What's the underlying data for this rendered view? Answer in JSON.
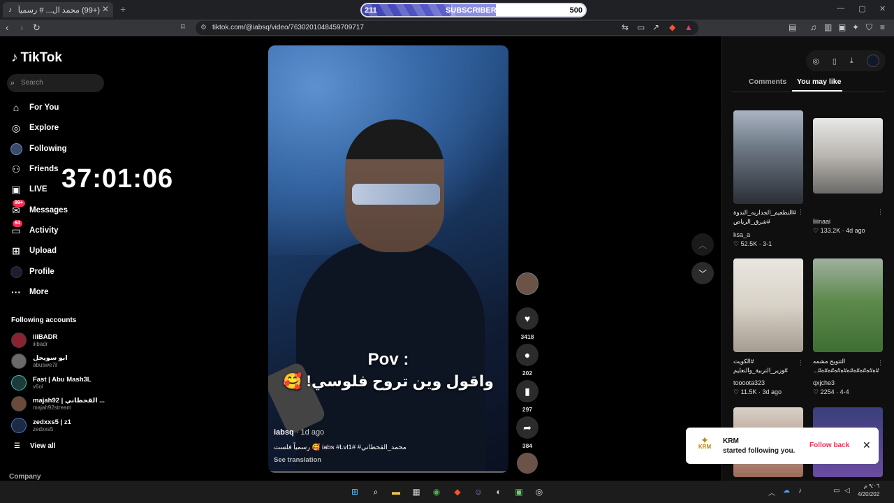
{
  "browser": {
    "tab_title": "(+99) محمد ال... # رسمياً فلست 🥰",
    "new_tab": "+",
    "url": "tiktok.com/@iabsq/video/7630201048459709717",
    "window_controls": [
      "—",
      "▢",
      "✕"
    ]
  },
  "subscriber_bar": {
    "current": "211",
    "label": "SUBSCRIBERS",
    "goal": "500",
    "progress": 0.42
  },
  "sidebar": {
    "logo": "TikTok",
    "search_placeholder": "Search",
    "nav": [
      {
        "label": "For You",
        "icon": "home-icon",
        "glyph": "⌂"
      },
      {
        "label": "Explore",
        "icon": "compass-icon",
        "glyph": "◎"
      },
      {
        "label": "Following",
        "icon": "following-avatar-icon",
        "glyph": "●"
      },
      {
        "label": "Friends",
        "icon": "friends-icon",
        "glyph": "👥"
      },
      {
        "label": "LIVE",
        "icon": "live-icon",
        "glyph": "▣"
      },
      {
        "label": "Messages",
        "icon": "messages-icon",
        "glyph": "✉",
        "badge": "99+"
      },
      {
        "label": "Activity",
        "icon": "activity-icon",
        "glyph": "▭",
        "badge": "64"
      },
      {
        "label": "Upload",
        "icon": "upload-icon",
        "glyph": "⊞"
      },
      {
        "label": "Profile",
        "icon": "profile-avatar-icon",
        "glyph": "●"
      },
      {
        "label": "More",
        "icon": "more-icon",
        "glyph": "···"
      }
    ],
    "following_title": "Following accounts",
    "accounts": [
      {
        "name": "iiiBADR",
        "handle": "iiibadr"
      },
      {
        "name": "ابو سويحل",
        "handle": "abuswe7il"
      },
      {
        "name": "Fast | Abu Mash3L",
        "handle": "v6ol"
      },
      {
        "name": "majah92 | القحطاني ...",
        "handle": "majah92stream"
      },
      {
        "name": "zedxxs5 | z1",
        "handle": "zedxxs5"
      }
    ],
    "view_all": "View all",
    "company": "Company"
  },
  "timer": "37:01:06",
  "video": {
    "overlay_title": "Pov :",
    "overlay_text": "واقول وين تروح فلوسي! 🥰",
    "author": "iabsq",
    "ago": "1d ago",
    "caption": "محمد_القحطاني# #iabs #Lvl1 🥰 رسمياً فلست",
    "see_translation": "See translation"
  },
  "actions": {
    "likes": "3418",
    "comments": "202",
    "saves": "297",
    "shares": "384"
  },
  "right_panel": {
    "tab_comments": "Comments",
    "tab_you_may_like": "You may like",
    "videos": [
      {
        "title": "#التطعيم_الجداريه_الندوة #شرق_الرياض",
        "author": "ksa_a",
        "likes": "52.5K",
        "date": "3-1"
      },
      {
        "title": "",
        "author": "liiinaai",
        "likes": "133.2K",
        "date": "4d ago"
      },
      {
        "title": "#الكويت #وزير_التربية_والتعليم",
        "author": "toooota323",
        "likes": "11.5K",
        "date": "3d ago"
      },
      {
        "title": "التتويج مشمه #ه#ه#ه#ه#ه#ه#ه#ه#ه#...",
        "author": "qxjche3",
        "likes": "2254",
        "date": "4-4"
      }
    ]
  },
  "toast": {
    "name": "KRM",
    "message": "started following you.",
    "follow_back": "Follow back",
    "logo_text": "KRM"
  },
  "taskbar": {
    "time": "٩:٠٦ م",
    "date": "4/20/202"
  }
}
